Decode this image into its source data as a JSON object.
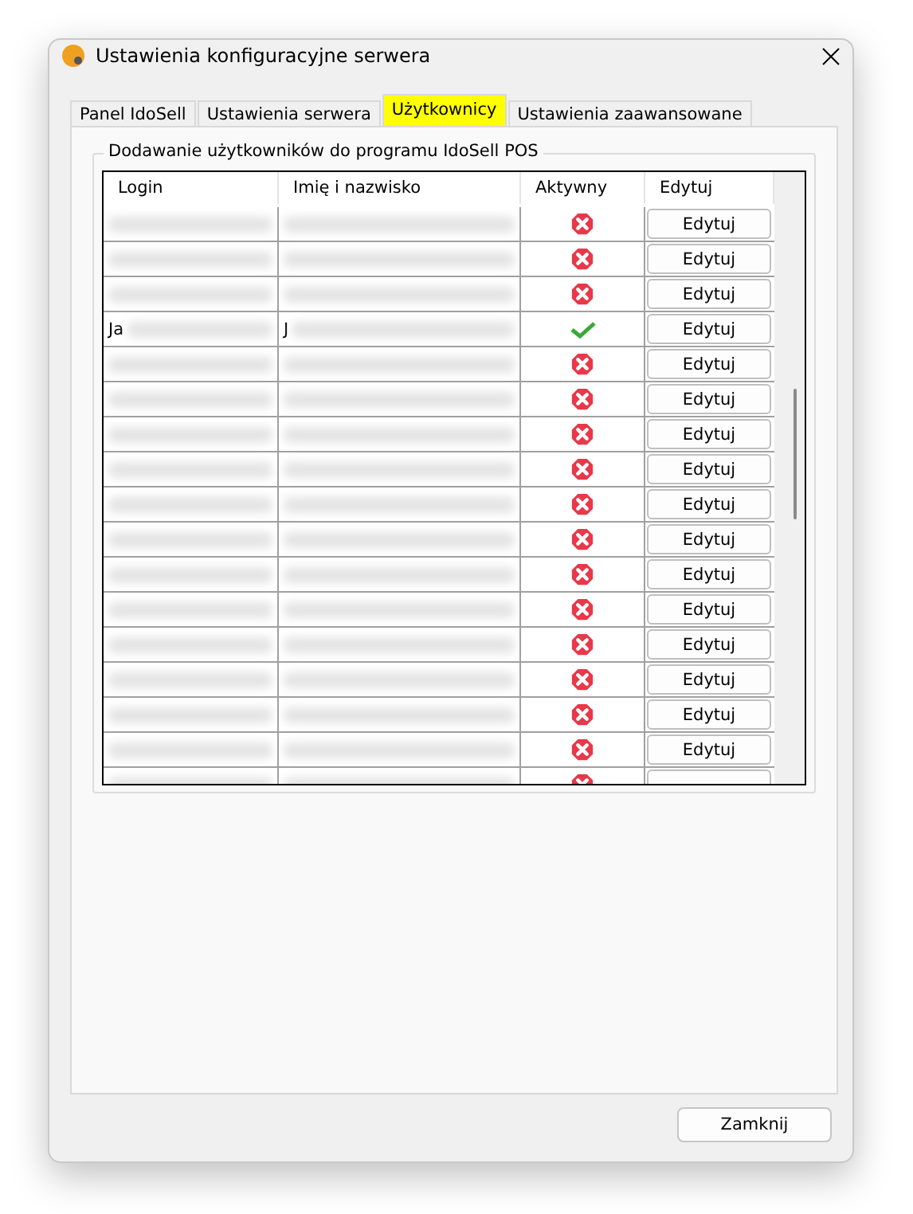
{
  "window": {
    "title": "Ustawienia konfiguracyjne serwera"
  },
  "tabs": [
    {
      "label": "Panel IdoSell",
      "selected": false
    },
    {
      "label": "Ustawienia serwera",
      "selected": false
    },
    {
      "label": "Użytkownicy",
      "selected": true
    },
    {
      "label": "Ustawienia zaawansowane",
      "selected": false
    }
  ],
  "group": {
    "title": "Dodawanie użytkowników do programu IdoSell POS"
  },
  "table": {
    "columns": [
      "Login",
      "Imię i nazwisko",
      "Aktywny",
      "Edytuj"
    ],
    "rows": [
      {
        "blurred": true,
        "active": false,
        "edit": "Edytuj"
      },
      {
        "blurred": true,
        "active": false,
        "edit": "Edytuj"
      },
      {
        "blurred": true,
        "active": false,
        "edit": "Edytuj"
      },
      {
        "login": "Ja",
        "name": "J",
        "blurred": true,
        "active": true,
        "edit": "Edytuj"
      },
      {
        "blurred": true,
        "active": false,
        "edit": "Edytuj"
      },
      {
        "blurred": true,
        "active": false,
        "edit": "Edytuj"
      },
      {
        "blurred": true,
        "active": false,
        "edit": "Edytuj"
      },
      {
        "blurred": true,
        "active": false,
        "edit": "Edytuj"
      },
      {
        "blurred": true,
        "active": false,
        "edit": "Edytuj"
      },
      {
        "blurred": true,
        "active": false,
        "edit": "Edytuj"
      },
      {
        "blurred": true,
        "active": false,
        "edit": "Edytuj"
      },
      {
        "blurred": true,
        "active": false,
        "edit": "Edytuj"
      },
      {
        "blurred": true,
        "active": false,
        "edit": "Edytuj"
      },
      {
        "blurred": true,
        "active": false,
        "edit": "Edytuj"
      },
      {
        "blurred": true,
        "active": false,
        "edit": "Edytuj"
      },
      {
        "blurred": true,
        "active": false,
        "edit": "Edytuj"
      },
      {
        "blurred": true,
        "active": false
      }
    ]
  },
  "buttons": [
    "Zamknij"
  ]
}
